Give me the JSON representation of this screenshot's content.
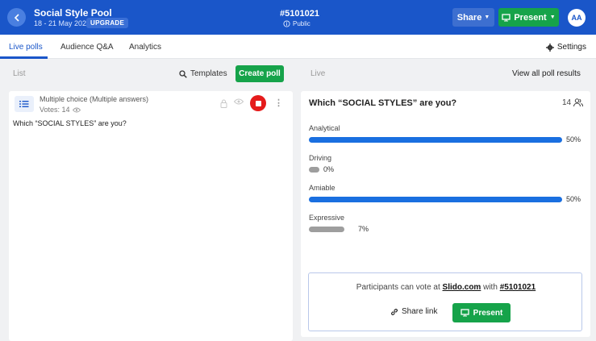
{
  "header": {
    "event_title": "Social Style Pool",
    "event_dates": "18 - 21 May 2023",
    "upgrade_label": "UPGRADE",
    "event_code": "#5101021",
    "privacy_label": "Public",
    "share_label": "Share",
    "present_label": "Present",
    "avatar_initials": "AA"
  },
  "tabs": {
    "items": [
      "Live polls",
      "Audience Q&A",
      "Analytics"
    ],
    "settings_label": "Settings"
  },
  "list_column": {
    "label": "List",
    "templates_label": "Templates",
    "create_poll_label": "Create poll"
  },
  "live_column": {
    "label": "Live",
    "view_all_label": "View all poll results"
  },
  "poll_card": {
    "type": "Multiple choice (Multiple answers)",
    "votes": "Votes: 14",
    "question": "Which “SOCIAL STYLES” are you?"
  },
  "live_poll": {
    "question": "Which “SOCIAL STYLES” are you?",
    "participants": "14",
    "options": [
      {
        "label": "Analytical",
        "percent": 50,
        "percent_label": "50%"
      },
      {
        "label": "Driving",
        "percent": 0,
        "percent_label": "0%"
      },
      {
        "label": "Amiable",
        "percent": 50,
        "percent_label": "50%"
      },
      {
        "label": "Expressive",
        "percent": 7,
        "percent_label": "7%"
      }
    ]
  },
  "vote_box": {
    "prefix": "Participants can vote at",
    "site": "Slido.com",
    "middle": "with",
    "code": "#5101021",
    "share_link_label": "Share link",
    "present_label": "Present"
  },
  "colors": {
    "header_bg": "#1a56c9",
    "accent_green": "#16a34a",
    "stop_red": "#e51b1b",
    "bar_blue": "#1a6fe0",
    "bar_grey": "#9e9e9e"
  }
}
